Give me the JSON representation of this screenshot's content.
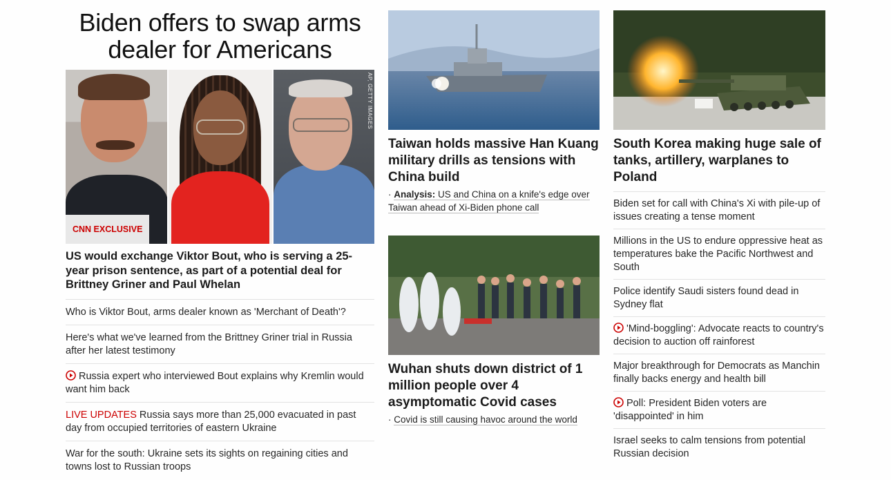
{
  "colors": {
    "accent": "#cc0000",
    "text": "#262626",
    "divider": "#e2e2e2"
  },
  "col1": {
    "headline": "Biden offers to swap arms dealer for Americans",
    "image_credit": "AP, GETTY IMAGES",
    "badge": "CNN Exclusive",
    "lead": "US would exchange Viktor Bout, who is serving a 25-year prison sentence, as part of a potential deal for Brittney Griner and Paul Whelan",
    "items": [
      {
        "text": "Who is Viktor Bout, arms dealer known as 'Merchant of Death'?"
      },
      {
        "text": "Here's what we've learned from the Brittney Griner trial in Russia after her latest testimony"
      },
      {
        "icon": "play-icon",
        "text": "Russia expert who interviewed Bout explains why Kremlin would want him back"
      },
      {
        "prefix": "LIVE UPDATES",
        "text": " Russia says more than 25,000 evacuated in past day from occupied territories of eastern Ukraine"
      },
      {
        "text": "War for the south: Ukraine sets its sights on regaining cities and towns lost to Russian troops"
      }
    ]
  },
  "col2": {
    "story1": {
      "headline": "Taiwan holds massive Han Kuang military drills as tensions with China build",
      "sub_label": "Analysis:",
      "sub_text": "US and China on a knife's edge over Taiwan ahead of Xi-Biden phone call"
    },
    "story2": {
      "headline": "Wuhan shuts down district of 1 million people over 4 asymptomatic Covid cases",
      "sub_text": "Covid is still causing havoc around the world"
    }
  },
  "col3": {
    "headline": "South Korea making huge sale of tanks, artillery, warplanes to Poland",
    "items": [
      {
        "text": "Biden set for call with China's Xi with pile-up of issues creating a tense moment"
      },
      {
        "text": "Millions in the US to endure oppressive heat as temperatures bake the Pacific Northwest and South"
      },
      {
        "text": "Police identify Saudi sisters found dead in Sydney flat"
      },
      {
        "icon": "play-icon",
        "text": "'Mind-boggling': Advocate reacts to country's decision to auction off rainforest"
      },
      {
        "text": "Major breakthrough for Democrats as Manchin finally backs energy and health bill"
      },
      {
        "icon": "play-icon",
        "text": "Poll: President Biden voters are 'disappointed' in him"
      },
      {
        "text": "Israel seeks to calm tensions from potential Russian decision"
      }
    ]
  }
}
